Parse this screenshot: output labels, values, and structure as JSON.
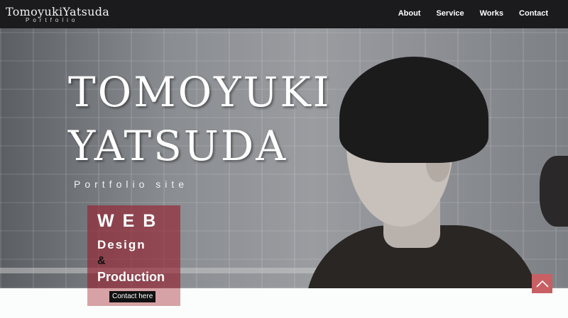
{
  "header": {
    "logo": "TomoyukiYatsuda",
    "logo_sub": "Portfolio",
    "nav": [
      "About",
      "Service",
      "Works",
      "Contact"
    ]
  },
  "hero": {
    "name_line1": "TOMOYUKI",
    "name_line2": "YATSUDA",
    "subtitle": "Portfolio site"
  },
  "promo": {
    "line1": "WEB",
    "line2": "Design",
    "line3": "&",
    "line4": "Production",
    "button": "Contact here"
  },
  "icons": {
    "scroll_top": "chevron-up-icon"
  },
  "colors": {
    "topbar": "#141416",
    "promo": "#961e2d",
    "promo_bottom": "#d7a2a5",
    "scroll_top": "#c85f63"
  }
}
